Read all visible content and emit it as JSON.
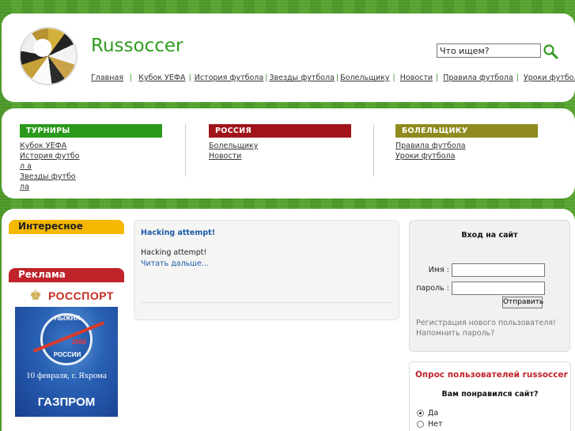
{
  "header": {
    "site_title": "Russoccer",
    "search_placeholder": "Что ищем?",
    "nav": [
      {
        "label": "Главная"
      },
      {
        "label": "Кубок УЕФА"
      },
      {
        "label": "История футбола"
      },
      {
        "label": "Звезды футбола"
      },
      {
        "label": "Болельщику"
      },
      {
        "label": "Новости"
      },
      {
        "label": "Правила футбола"
      },
      {
        "label": "Уроки футбола"
      }
    ]
  },
  "categories": [
    {
      "title": "ТУРНИРЫ",
      "color": "#2a9a1c",
      "links": [
        "Кубок УЕФА",
        "История футбол а",
        "Звезды футбола"
      ]
    },
    {
      "title": "РОССИЯ",
      "color": "#a0141a",
      "links": [
        "Болельщику",
        "Новости"
      ]
    },
    {
      "title": "БОЛЕЛЬЩИКУ",
      "color": "#8f8a1e",
      "links": [
        "Правила футбола",
        "Уроки футбола"
      ]
    }
  ],
  "sidebar": {
    "interesting_tab": "Интересное",
    "interesting_color": "#f5b800",
    "ads_tab": "Реклама",
    "ads_color": "#c0232a",
    "banner": {
      "brand": "РОССПОРТ",
      "arc_top": "ЛЫЖНЯ",
      "arc_bottom": "РОССИИ",
      "year": "2008",
      "date": "10 февраля, г. Яхрома",
      "sponsor": "ГАЗПРОМ"
    }
  },
  "article": {
    "title": "Hacking attempt!",
    "body": "Hacking attempt!",
    "read_more": "Читать дальше..."
  },
  "login": {
    "title": "Вход на сайт",
    "name_label": "Имя :",
    "password_label": "пароль :",
    "submit_label": "Отправить",
    "register_link": "Регистрация нового пользователя!",
    "forgot_link": "Напомнить пароль?"
  },
  "poll": {
    "title": "Опрос пользователей russoccer",
    "question": "Вам понравился сайт?",
    "options": [
      {
        "label": "Да",
        "selected": true
      },
      {
        "label": "Нет",
        "selected": false
      }
    ]
  }
}
